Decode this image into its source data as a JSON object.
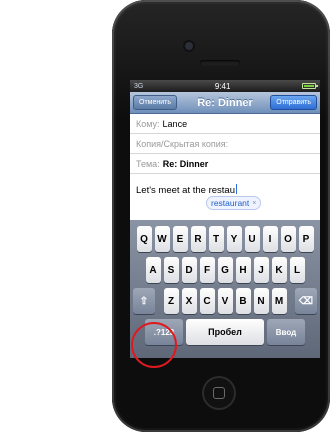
{
  "status_bar": {
    "signal": "3G",
    "time": "9:41"
  },
  "nav": {
    "cancel_label": "Отменить",
    "title": "Re: Dinner",
    "send_label": "Отправить"
  },
  "fields": {
    "to_label": "Кому:",
    "to_value": "Lance",
    "cc_label": "Копия/Скрытая копия:",
    "subject_label": "Тема:",
    "subject_value": "Re: Dinner"
  },
  "message": {
    "text": "Let's meet at the restau",
    "suggestion": "restaurant",
    "suggestion_close": "×"
  },
  "keyboard": {
    "row1": [
      "Q",
      "W",
      "E",
      "R",
      "T",
      "Y",
      "U",
      "I",
      "O",
      "P"
    ],
    "row2": [
      "A",
      "S",
      "D",
      "F",
      "G",
      "H",
      "J",
      "K",
      "L"
    ],
    "row3": [
      "Z",
      "X",
      "C",
      "V",
      "B",
      "N",
      "M"
    ],
    "shift": "⇧",
    "delete": "⌫",
    "numbers": ".?123",
    "space": "Пробел",
    "enter": "Ввод"
  },
  "colors": {
    "highlight": "#e0191f",
    "accent": "#2f6ed6"
  }
}
